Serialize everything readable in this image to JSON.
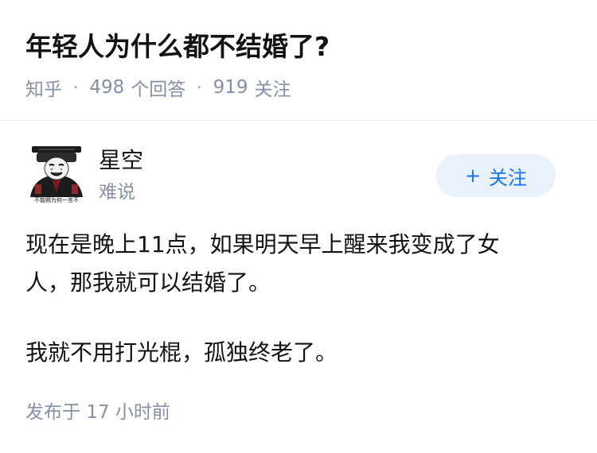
{
  "question": {
    "title": "年轻人为什么都不结婚了?",
    "source": "知乎",
    "answer_count": "498",
    "answer_label": "个回答",
    "follow_count": "919",
    "follow_label": "关注"
  },
  "author": {
    "name": "星空",
    "headline": "难说",
    "avatar_icon": "meme-avatar-icon",
    "avatar_caption": "不能赐为何一言不",
    "follow_button_icon": "+",
    "follow_button_label": "关注"
  },
  "answer": {
    "paragraphs": [
      "现在是晚上11点，如果明天早上醒来我变成了女人，那我就可以结婚了。",
      "我就不用打光棍，孤独终老了。"
    ],
    "time_prefix": "发布于",
    "time_value": "17 小时前"
  },
  "colors": {
    "primary_text": "#121212",
    "secondary_text": "#8590a6",
    "accent_blue": "#1772f6",
    "follow_button_bg": "#e9f1fb",
    "divider": "#ebebeb"
  }
}
